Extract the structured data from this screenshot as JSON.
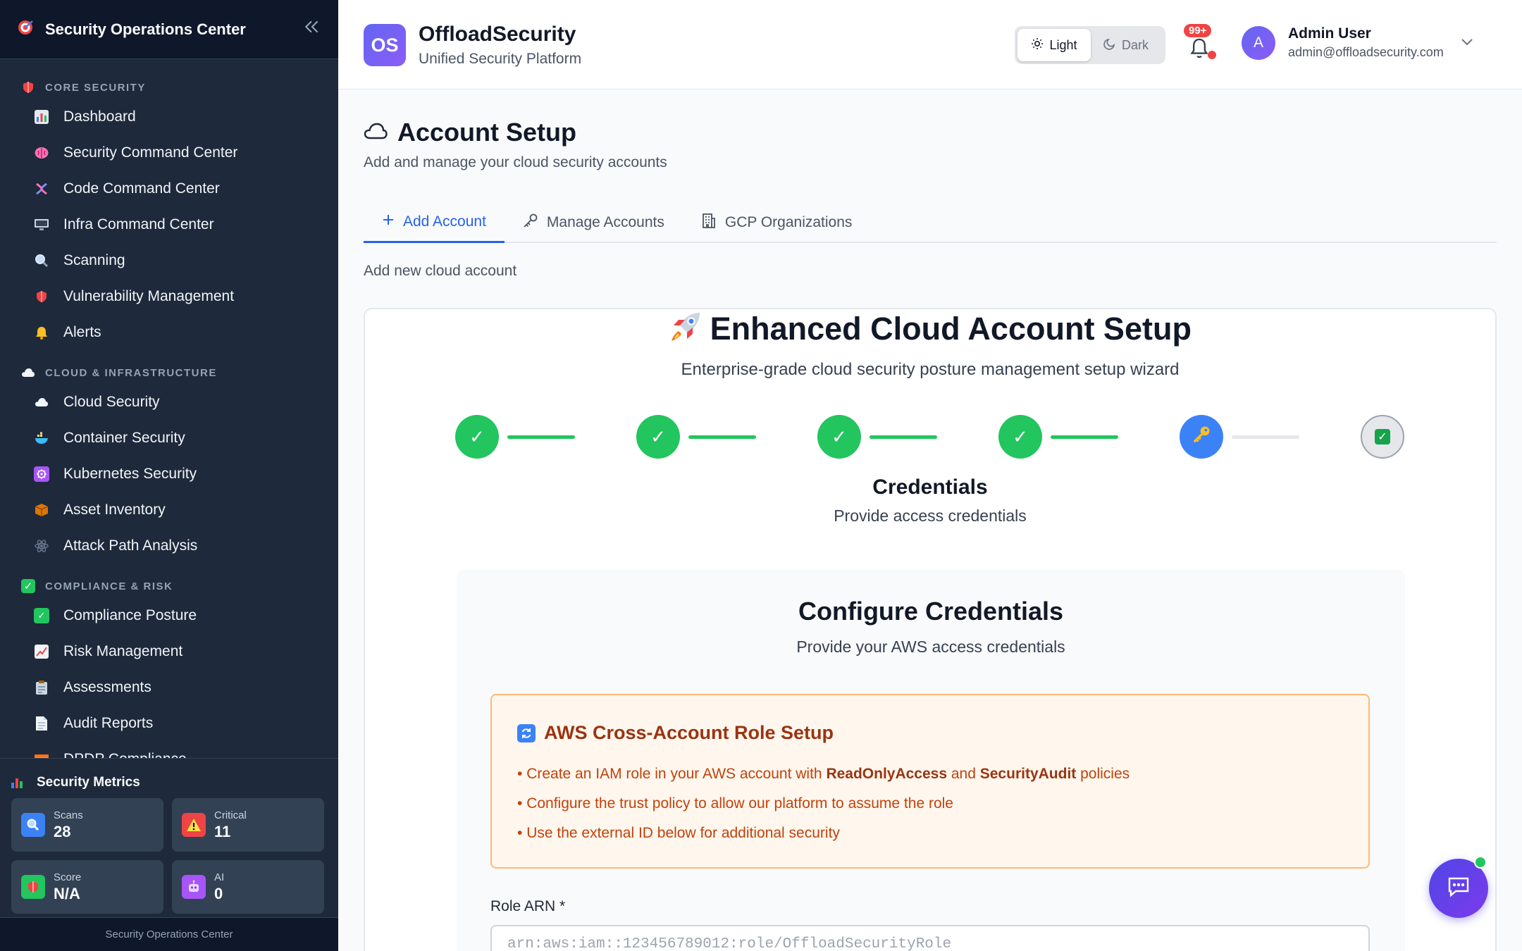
{
  "sidebar": {
    "title": "Security Operations Center",
    "sections": [
      {
        "label": "CORE SECURITY",
        "items": [
          {
            "label": "Dashboard",
            "icon": "bar-chart-icon",
            "color": "#3b82f6"
          },
          {
            "label": "Security Command Center",
            "icon": "brain-icon",
            "color": "#ec4899"
          },
          {
            "label": "Code Command Center",
            "icon": "dna-icon",
            "color": "#6366f1"
          },
          {
            "label": "Infra Command Center",
            "icon": "monitor-icon",
            "color": "#64748b"
          },
          {
            "label": "Scanning",
            "icon": "magnifier-icon",
            "color": "#94a3b8"
          },
          {
            "label": "Vulnerability Management",
            "icon": "shield-icon",
            "color": "#ef4444"
          },
          {
            "label": "Alerts",
            "icon": "bell-icon",
            "color": "#f59e0b"
          }
        ]
      },
      {
        "label": "CLOUD & INFRASTRUCTURE",
        "items": [
          {
            "label": "Cloud Security",
            "icon": "cloud-icon",
            "color": "#e2e8f0"
          },
          {
            "label": "Container Security",
            "icon": "whale-icon",
            "color": "#0ea5e9"
          },
          {
            "label": "Kubernetes Security",
            "icon": "helm-icon",
            "color": "#a855f7"
          },
          {
            "label": "Asset Inventory",
            "icon": "package-icon",
            "color": "#d97706"
          },
          {
            "label": "Attack Path Analysis",
            "icon": "network-icon",
            "color": "#475569"
          }
        ]
      },
      {
        "label": "COMPLIANCE & RISK",
        "items": [
          {
            "label": "Compliance Posture",
            "icon": "check-box-icon",
            "color": "#22c55e"
          },
          {
            "label": "Risk Management",
            "icon": "trend-chart-icon",
            "color": "#f472b6"
          },
          {
            "label": "Assessments",
            "icon": "clipboard-icon",
            "color": "#cbd5e1"
          },
          {
            "label": "Audit Reports",
            "icon": "document-icon",
            "color": "#e2e8f0"
          },
          {
            "label": "DPDP Compliance",
            "icon": "india-flag-icon",
            "color": "#f97316"
          }
        ]
      }
    ],
    "metrics": {
      "title": "Security Metrics",
      "cards": [
        {
          "label": "Scans",
          "value": "28",
          "icon": "magnifier-icon",
          "color": "#3b82f6"
        },
        {
          "label": "Critical",
          "value": "11",
          "icon": "warning-icon",
          "color": "#ef4444"
        },
        {
          "label": "Score",
          "value": "N/A",
          "icon": "shield-icon",
          "color": "#22c55e"
        },
        {
          "label": "AI",
          "value": "0",
          "icon": "robot-icon",
          "color": "#a855f7"
        }
      ]
    },
    "footer": "Security Operations Center"
  },
  "topbar": {
    "brand_initials": "OS",
    "brand_name": "OffloadSecurity",
    "brand_tagline": "Unified Security Platform",
    "theme_light": "Light",
    "theme_dark": "Dark",
    "notifications_count": "99+",
    "user_initial": "A",
    "user_name": "Admin User",
    "user_email": "admin@offloadsecurity.com"
  },
  "page": {
    "title": "Account Setup",
    "subtitle": "Add and manage your cloud security accounts",
    "tabs": [
      {
        "label": "Add Account",
        "icon": "plus-icon",
        "active": true
      },
      {
        "label": "Manage Accounts",
        "icon": "key-icon",
        "active": false
      },
      {
        "label": "GCP Organizations",
        "icon": "building-icon",
        "active": false
      }
    ],
    "section_label": "Add new cloud account"
  },
  "wizard": {
    "title": "Enhanced Cloud Account Setup",
    "title_icon": "rocket-icon",
    "subtitle": "Enterprise-grade cloud security posture management setup wizard",
    "steps": [
      {
        "state": "done",
        "glyph": "✓"
      },
      {
        "state": "done",
        "glyph": "✓"
      },
      {
        "state": "done",
        "glyph": "✓"
      },
      {
        "state": "done",
        "glyph": "✓"
      },
      {
        "state": "current",
        "glyph": "🔑"
      },
      {
        "state": "pending",
        "glyph": "✓"
      }
    ],
    "current_step_name": "Credentials",
    "current_step_desc": "Provide access credentials",
    "form": {
      "heading": "Configure Credentials",
      "subheading": "Provide your AWS access credentials",
      "notice": {
        "title": "AWS Cross-Account Role Setup",
        "line1_pre": "Create an IAM role in your AWS account with ",
        "line1_b1": "ReadOnlyAccess",
        "line1_mid": " and ",
        "line1_b2": "SecurityAudit",
        "line1_post": " policies",
        "line2": "Configure the trust policy to allow our platform to assume the role",
        "line3": "Use the external ID below for additional security"
      },
      "role_arn_label": "Role ARN *",
      "role_arn_placeholder": "arn:aws:iam::123456789012:role/OffloadSecurityRole"
    }
  },
  "colors": {
    "accent": "#2563eb",
    "success": "#22c55e",
    "sidebar_bg": "#1e293b",
    "notice_bg": "#fff7ed",
    "notice_text": "#c2410c"
  }
}
